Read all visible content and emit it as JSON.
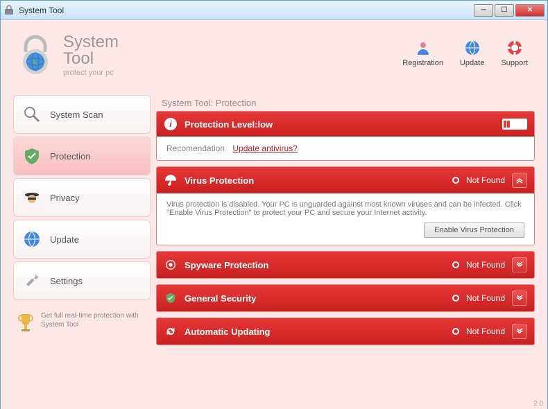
{
  "window": {
    "title": "System Tool"
  },
  "logo": {
    "line1": "System",
    "line2": "Tool",
    "sub": "protect your pc"
  },
  "header_links": {
    "registration": "Registration",
    "update": "Update",
    "support": "Support"
  },
  "sidebar": {
    "items": [
      {
        "label": "System Scan"
      },
      {
        "label": "Protection"
      },
      {
        "label": "Privacy"
      },
      {
        "label": "Update"
      },
      {
        "label": "Settings"
      }
    ]
  },
  "promo": {
    "text": "Get full real-time protection with System Tool"
  },
  "panel": {
    "title": "System Tool: Protection",
    "level": {
      "label": "Protection Level:low"
    },
    "recommendation": {
      "label": "Recomendation",
      "link": "Update antivirus?"
    },
    "virus": {
      "title": "Virus Protection",
      "status": "Not Found",
      "body": "Virus protection is disabled. Your PC is unguarded against most known viruses and can be infected. Click \"Enable Virus Protection\" to protect your PC and secure your Internet activity.",
      "button": "Enable Virus Protection"
    },
    "spyware": {
      "title": "Spyware Protection",
      "status": "Not Found"
    },
    "general": {
      "title": "General Security",
      "status": "Not Found"
    },
    "auto": {
      "title": "Automatic Updating",
      "status": "Not Found"
    }
  },
  "version": "2.0"
}
